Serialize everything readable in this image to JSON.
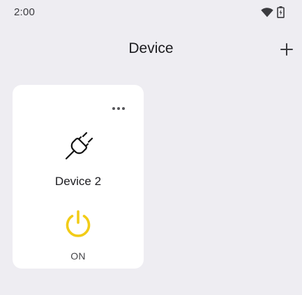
{
  "status_bar": {
    "time": "2:00",
    "icons": [
      "wifi-icon",
      "battery-charging-icon"
    ]
  },
  "header": {
    "title": "Device",
    "add_icon": "plus-icon"
  },
  "devices": [
    {
      "name": "Device 2",
      "icon": "plug-icon",
      "menu_icon": "more-horizontal-icon",
      "power_icon": "power-icon",
      "status": "ON"
    }
  ],
  "colors": {
    "background": "#EEEDF2",
    "card": "#FFFFFF",
    "power_on": "#F2CC17",
    "text": "#1B1B1F"
  }
}
